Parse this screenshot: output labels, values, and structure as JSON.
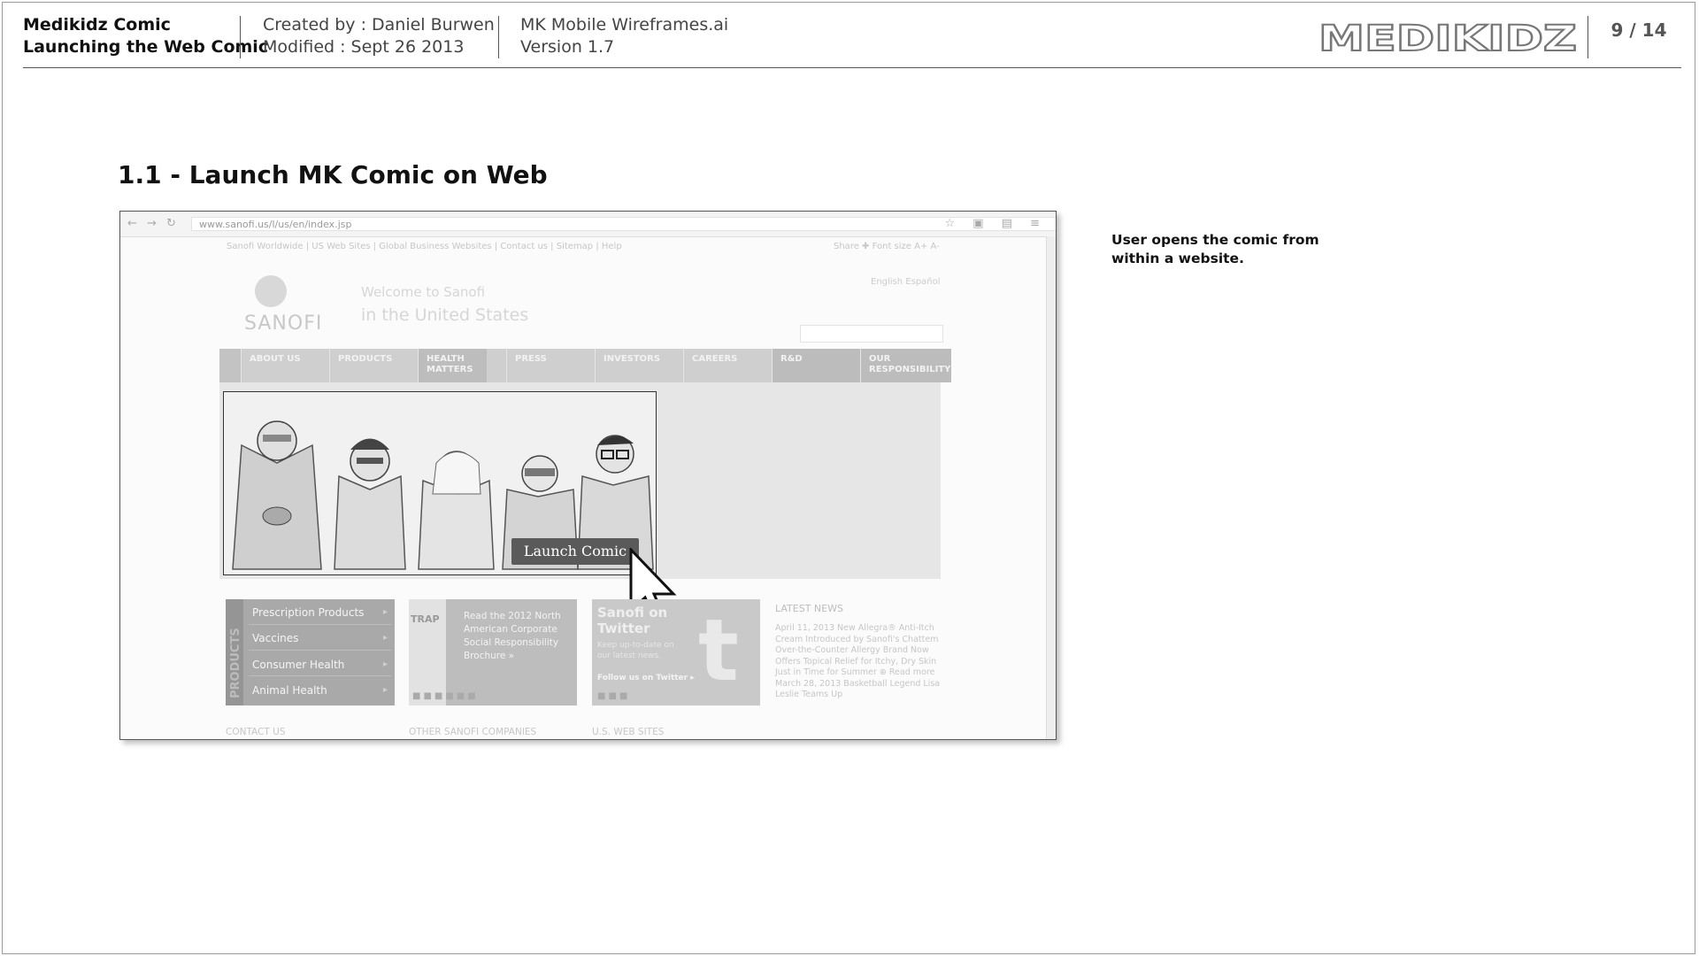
{
  "header": {
    "doc_title": "Medikidz Comic",
    "doc_subtitle": "Launching the Web Comic",
    "created_by": "Created by : Daniel Burwen",
    "modified": "Modified : Sept 26 2013",
    "file_name": "MK Mobile Wireframes.ai",
    "version": "Version 1.7",
    "logo_text": "MEDIKIDZ",
    "page_indicator": "9 / 14"
  },
  "section": {
    "title": "1.1 - Launch MK Comic on Web"
  },
  "browser": {
    "url": "www.sanofi.us/l/us/en/index.jsp",
    "top_links": "Sanofi Worldwide  |  US Web Sites  |  Global Business Websites  |  Contact us  |  Sitemap  |  Help",
    "top_right": "Share  ✚  Font size  A+  A-",
    "languages": "English  Español",
    "brand_name": "SANOFI",
    "welcome_line1": "Welcome to Sanofi",
    "welcome_line2": "in the United States",
    "menu": [
      "ABOUT US",
      "PRODUCTS",
      "HEALTH MATTERS",
      "PRESS",
      "INVESTORS",
      "CAREERS",
      "R&D",
      "OUR RESPONSIBILITY"
    ],
    "launch_button": "Launch Comic",
    "products_side_label": "PRODUCTS",
    "products": [
      "Prescription Products",
      "Vaccines",
      "Consumer Health",
      "Animal Health"
    ],
    "promo_title": "TRAP",
    "promo_text": "Read the 2012 North American Corporate Social Responsibility Brochure »",
    "twitter_title": "Sanofi on Twitter",
    "twitter_sub": "Keep up-to-date on our latest news.",
    "twitter_follow": "Follow us on Twitter ▸",
    "news_heading": "LATEST NEWS",
    "news_items": "April 11, 2013 New Allegra® Anti-Itch Cream Introduced by Sanofi's Chattem Over-the-Counter Allergy Brand Now Offers Topical Relief for Itchy, Dry Skin Just in Time for Summer ⊕ Read more March 28, 2013 Basketball Legend Lisa Leslie Teams Up",
    "footer_labels": [
      "CONTACT US",
      "OTHER SANOFI COMPANIES",
      "U.S. WEB SITES"
    ]
  },
  "note": {
    "text": "User opens the comic from within a website."
  }
}
